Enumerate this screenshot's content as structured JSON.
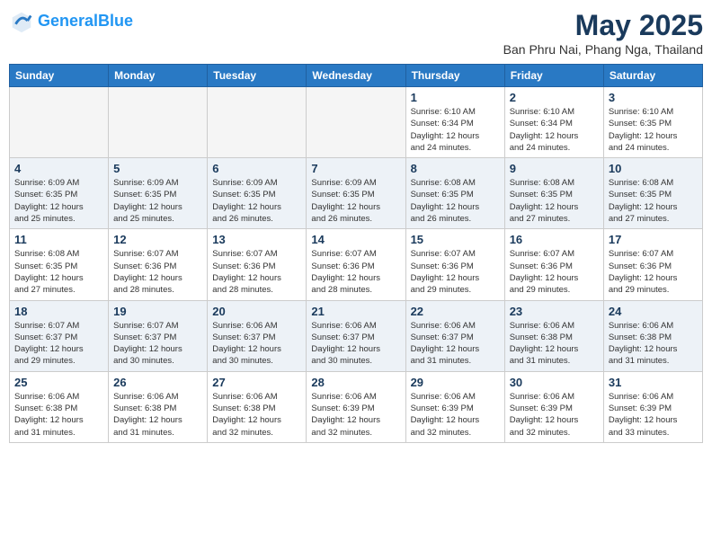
{
  "header": {
    "logo_line1": "General",
    "logo_line2": "Blue",
    "month_year": "May 2025",
    "location": "Ban Phru Nai, Phang Nga, Thailand"
  },
  "weekdays": [
    "Sunday",
    "Monday",
    "Tuesday",
    "Wednesday",
    "Thursday",
    "Friday",
    "Saturday"
  ],
  "weeks": [
    [
      {
        "day": "",
        "info": ""
      },
      {
        "day": "",
        "info": ""
      },
      {
        "day": "",
        "info": ""
      },
      {
        "day": "",
        "info": ""
      },
      {
        "day": "1",
        "info": "Sunrise: 6:10 AM\nSunset: 6:34 PM\nDaylight: 12 hours\nand 24 minutes."
      },
      {
        "day": "2",
        "info": "Sunrise: 6:10 AM\nSunset: 6:34 PM\nDaylight: 12 hours\nand 24 minutes."
      },
      {
        "day": "3",
        "info": "Sunrise: 6:10 AM\nSunset: 6:35 PM\nDaylight: 12 hours\nand 24 minutes."
      }
    ],
    [
      {
        "day": "4",
        "info": "Sunrise: 6:09 AM\nSunset: 6:35 PM\nDaylight: 12 hours\nand 25 minutes."
      },
      {
        "day": "5",
        "info": "Sunrise: 6:09 AM\nSunset: 6:35 PM\nDaylight: 12 hours\nand 25 minutes."
      },
      {
        "day": "6",
        "info": "Sunrise: 6:09 AM\nSunset: 6:35 PM\nDaylight: 12 hours\nand 26 minutes."
      },
      {
        "day": "7",
        "info": "Sunrise: 6:09 AM\nSunset: 6:35 PM\nDaylight: 12 hours\nand 26 minutes."
      },
      {
        "day": "8",
        "info": "Sunrise: 6:08 AM\nSunset: 6:35 PM\nDaylight: 12 hours\nand 26 minutes."
      },
      {
        "day": "9",
        "info": "Sunrise: 6:08 AM\nSunset: 6:35 PM\nDaylight: 12 hours\nand 27 minutes."
      },
      {
        "day": "10",
        "info": "Sunrise: 6:08 AM\nSunset: 6:35 PM\nDaylight: 12 hours\nand 27 minutes."
      }
    ],
    [
      {
        "day": "11",
        "info": "Sunrise: 6:08 AM\nSunset: 6:35 PM\nDaylight: 12 hours\nand 27 minutes."
      },
      {
        "day": "12",
        "info": "Sunrise: 6:07 AM\nSunset: 6:36 PM\nDaylight: 12 hours\nand 28 minutes."
      },
      {
        "day": "13",
        "info": "Sunrise: 6:07 AM\nSunset: 6:36 PM\nDaylight: 12 hours\nand 28 minutes."
      },
      {
        "day": "14",
        "info": "Sunrise: 6:07 AM\nSunset: 6:36 PM\nDaylight: 12 hours\nand 28 minutes."
      },
      {
        "day": "15",
        "info": "Sunrise: 6:07 AM\nSunset: 6:36 PM\nDaylight: 12 hours\nand 29 minutes."
      },
      {
        "day": "16",
        "info": "Sunrise: 6:07 AM\nSunset: 6:36 PM\nDaylight: 12 hours\nand 29 minutes."
      },
      {
        "day": "17",
        "info": "Sunrise: 6:07 AM\nSunset: 6:36 PM\nDaylight: 12 hours\nand 29 minutes."
      }
    ],
    [
      {
        "day": "18",
        "info": "Sunrise: 6:07 AM\nSunset: 6:37 PM\nDaylight: 12 hours\nand 29 minutes."
      },
      {
        "day": "19",
        "info": "Sunrise: 6:07 AM\nSunset: 6:37 PM\nDaylight: 12 hours\nand 30 minutes."
      },
      {
        "day": "20",
        "info": "Sunrise: 6:06 AM\nSunset: 6:37 PM\nDaylight: 12 hours\nand 30 minutes."
      },
      {
        "day": "21",
        "info": "Sunrise: 6:06 AM\nSunset: 6:37 PM\nDaylight: 12 hours\nand 30 minutes."
      },
      {
        "day": "22",
        "info": "Sunrise: 6:06 AM\nSunset: 6:37 PM\nDaylight: 12 hours\nand 31 minutes."
      },
      {
        "day": "23",
        "info": "Sunrise: 6:06 AM\nSunset: 6:38 PM\nDaylight: 12 hours\nand 31 minutes."
      },
      {
        "day": "24",
        "info": "Sunrise: 6:06 AM\nSunset: 6:38 PM\nDaylight: 12 hours\nand 31 minutes."
      }
    ],
    [
      {
        "day": "25",
        "info": "Sunrise: 6:06 AM\nSunset: 6:38 PM\nDaylight: 12 hours\nand 31 minutes."
      },
      {
        "day": "26",
        "info": "Sunrise: 6:06 AM\nSunset: 6:38 PM\nDaylight: 12 hours\nand 31 minutes."
      },
      {
        "day": "27",
        "info": "Sunrise: 6:06 AM\nSunset: 6:38 PM\nDaylight: 12 hours\nand 32 minutes."
      },
      {
        "day": "28",
        "info": "Sunrise: 6:06 AM\nSunset: 6:39 PM\nDaylight: 12 hours\nand 32 minutes."
      },
      {
        "day": "29",
        "info": "Sunrise: 6:06 AM\nSunset: 6:39 PM\nDaylight: 12 hours\nand 32 minutes."
      },
      {
        "day": "30",
        "info": "Sunrise: 6:06 AM\nSunset: 6:39 PM\nDaylight: 12 hours\nand 32 minutes."
      },
      {
        "day": "31",
        "info": "Sunrise: 6:06 AM\nSunset: 6:39 PM\nDaylight: 12 hours\nand 33 minutes."
      }
    ]
  ]
}
